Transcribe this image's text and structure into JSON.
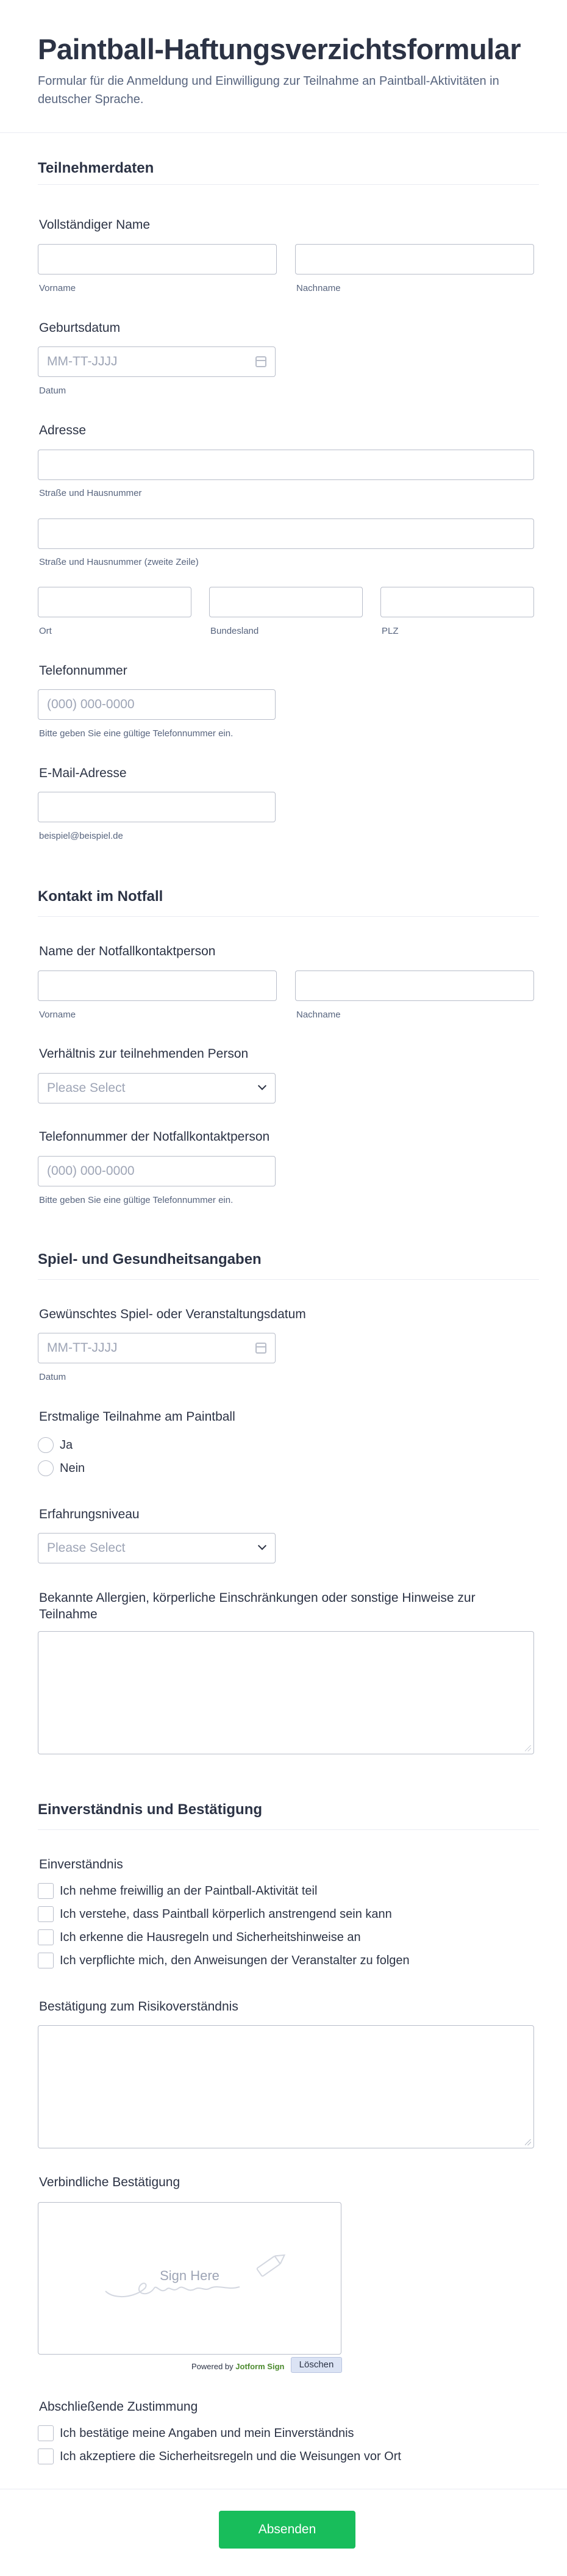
{
  "header": {
    "title": "Paintball-Haftungsverzichtsformular",
    "subtitle": "Formular für die Anmeldung und Einwilligung zur Teilnahme an Paintball-Aktivitäten in deutscher Sprache."
  },
  "participant": {
    "section_title": "Teilnehmerdaten",
    "full_name": {
      "label": "Vollständiger Name",
      "first": "Vorname",
      "last": "Nachname"
    },
    "birthdate": {
      "label": "Geburtsdatum",
      "placeholder": "MM-TT-JJJJ",
      "sublabel": "Datum"
    },
    "address": {
      "label": "Adresse",
      "street": "Straße und Hausnummer",
      "street2": "Straße und Hausnummer (zweite Zeile)",
      "city": "Ort",
      "state": "Bundesland",
      "zip": "PLZ"
    },
    "phone": {
      "label": "Telefonnummer",
      "placeholder": "(000) 000-0000",
      "sublabel": "Bitte geben Sie eine gültige Telefonnummer ein."
    },
    "email": {
      "label": "E-Mail-Adresse",
      "sublabel": "beispiel@beispiel.de"
    }
  },
  "emergency": {
    "section_title": "Kontakt im Notfall",
    "name": {
      "label": "Name der Notfallkontaktperson",
      "first": "Vorname",
      "last": "Nachname"
    },
    "relation": {
      "label": "Verhältnis zur teilnehmenden Person",
      "placeholder": "Please Select"
    },
    "phone": {
      "label": "Telefonnummer der Notfallkontaktperson",
      "placeholder": "(000) 000-0000",
      "sublabel": "Bitte geben Sie eine gültige Telefonnummer ein."
    }
  },
  "game": {
    "section_title": "Spiel- und Gesundheitsangaben",
    "date": {
      "label": "Gewünschtes Spiel- oder Veranstaltungsdatum",
      "placeholder": "MM-TT-JJJJ",
      "sublabel": "Datum"
    },
    "first_time": {
      "label": "Erstmalige Teilnahme am Paintball",
      "options": [
        "Ja",
        "Nein"
      ]
    },
    "experience": {
      "label": "Erfahrungsniveau",
      "placeholder": "Please Select"
    },
    "allergies": {
      "label": "Bekannte Allergien, körperliche Einschränkungen oder sonstige Hinweise zur Teilnahme"
    }
  },
  "consent": {
    "section_title": "Einverständnis und Bestätigung",
    "agreement": {
      "label": "Einverständnis",
      "options": [
        "Ich nehme freiwillig an der Paintball-Aktivität teil",
        "Ich verstehe, dass Paintball körperlich anstrengend sein kann",
        "Ich erkenne die Hausregeln und Sicherheitshinweise an",
        "Ich verpflichte mich, den Anweisungen der Veranstalter zu folgen"
      ]
    },
    "risk": {
      "label": "Bestätigung zum Risikoverständnis"
    },
    "signature": {
      "label": "Verbindliche Bestätigung",
      "placeholder": "Sign Here",
      "powered_by": "Powered by",
      "brand": "Jotform Sign",
      "clear": "Löschen"
    },
    "final": {
      "label": "Abschließende Zustimmung",
      "options": [
        "Ich bestätige meine Angaben und mein Einverständnis",
        "Ich akzeptiere die Sicherheitsregeln und die Weisungen vor Ort"
      ]
    }
  },
  "submit": {
    "label": "Absenden"
  },
  "colors": {
    "accent": "#18bd5b",
    "text": "#2c3345",
    "muted": "#57647e",
    "border": "#b8bdc9",
    "brand": "#4c8a2f"
  }
}
